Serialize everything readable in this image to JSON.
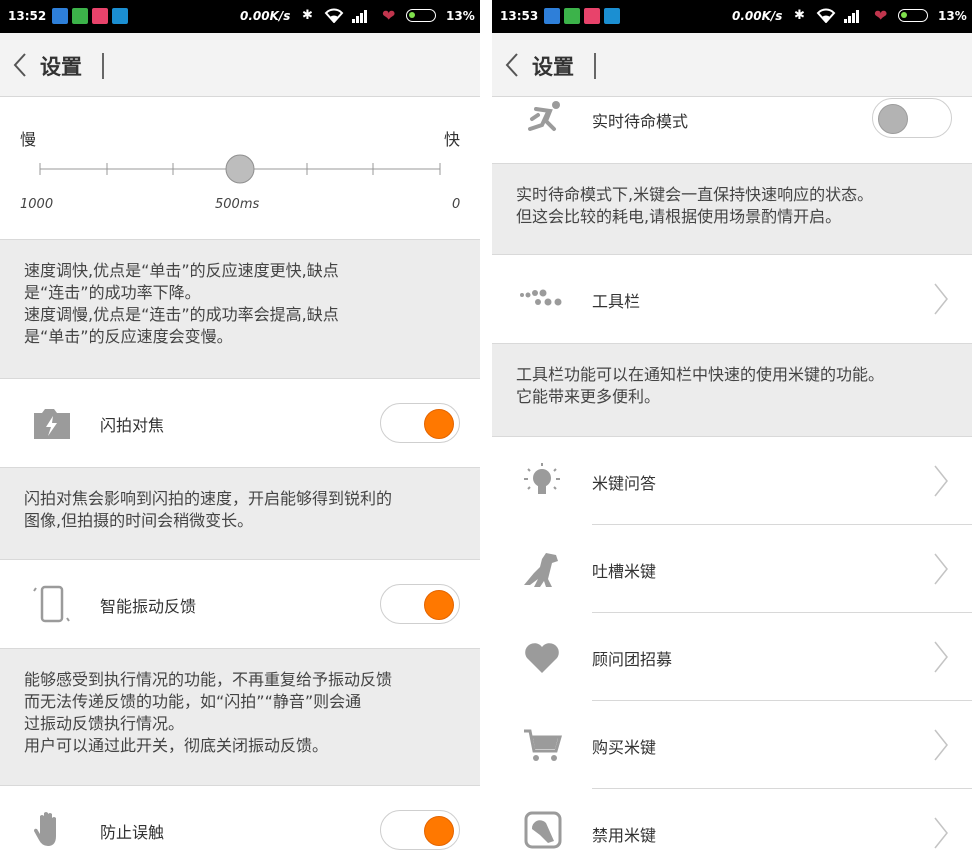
{
  "left": {
    "status": {
      "time": "13:52",
      "speed": "0.00K/s",
      "battery": "13%"
    },
    "header": {
      "title": "设置"
    },
    "speed_slider": {
      "slow_label": "慢",
      "fast_label": "快",
      "min_label": "1000",
      "mid_label": "500ms",
      "max_label": "0",
      "value_fraction": 0.5
    },
    "speed_desc": {
      "line1": "速度调快,优点是“单击”的反应速度更快,缺点",
      "line2": "是“连击”的成功率下降。",
      "line3": "速度调慢,优点是“连击”的成功率会提高,缺点",
      "line4": "是“单击”的反应速度会变慢。"
    },
    "flash_focus": {
      "label": "闪拍对焦",
      "icon": "flash-camera-icon",
      "enabled": true
    },
    "flash_desc": {
      "line1": "闪拍对焦会影响到闪拍的速度，开启能够得到锐利的",
      "line2": "图像,但拍摄的时间会稍微变长。"
    },
    "vibration": {
      "label": "智能振动反馈",
      "icon": "vibrating-phone-icon",
      "enabled": true
    },
    "vibration_desc": {
      "line1": "能够感受到执行情况的功能，不再重复给予振动反馈",
      "line2": "而无法传递反馈的功能，如“闪拍”“静音”则会通",
      "line3": "过振动反馈执行情况。",
      "line4": "用户可以通过此开关，彻底关闭振动反馈。"
    },
    "prevent_touch": {
      "label": "防止误触",
      "icon": "hand-icon",
      "enabled": true
    }
  },
  "right": {
    "status": {
      "time": "13:53",
      "speed": "0.00K/s",
      "battery": "13%"
    },
    "header": {
      "title": "设置"
    },
    "standby": {
      "label": "实时待命模式",
      "icon": "running-person-icon",
      "enabled": false
    },
    "standby_desc": {
      "line1": "实时待命模式下,米键会一直保持快速响应的状态。",
      "line2": "但这会比较的耗电,请根据使用场景酌情开启。"
    },
    "toolbar": {
      "label": "工具栏",
      "icon": "dots-icon"
    },
    "toolbar_desc": {
      "line1": "工具栏功能可以在通知栏中快速的使用米键的功能。",
      "line2": "它能带来更多便利。"
    },
    "menu": [
      {
        "label": "米键问答",
        "icon": "lightbulb-icon"
      },
      {
        "label": "吐槽米键",
        "icon": "dinosaur-icon"
      },
      {
        "label": "顾问团招募",
        "icon": "heart-icon"
      },
      {
        "label": "购买米键",
        "icon": "cart-icon"
      },
      {
        "label": "禁用米键",
        "icon": "disable-key-icon"
      }
    ]
  },
  "colors": {
    "accent": "#ff7800",
    "toggle_off": "#b3b3b3",
    "icon_gray": "#9b9b9b",
    "desc_bg": "#ececec"
  }
}
